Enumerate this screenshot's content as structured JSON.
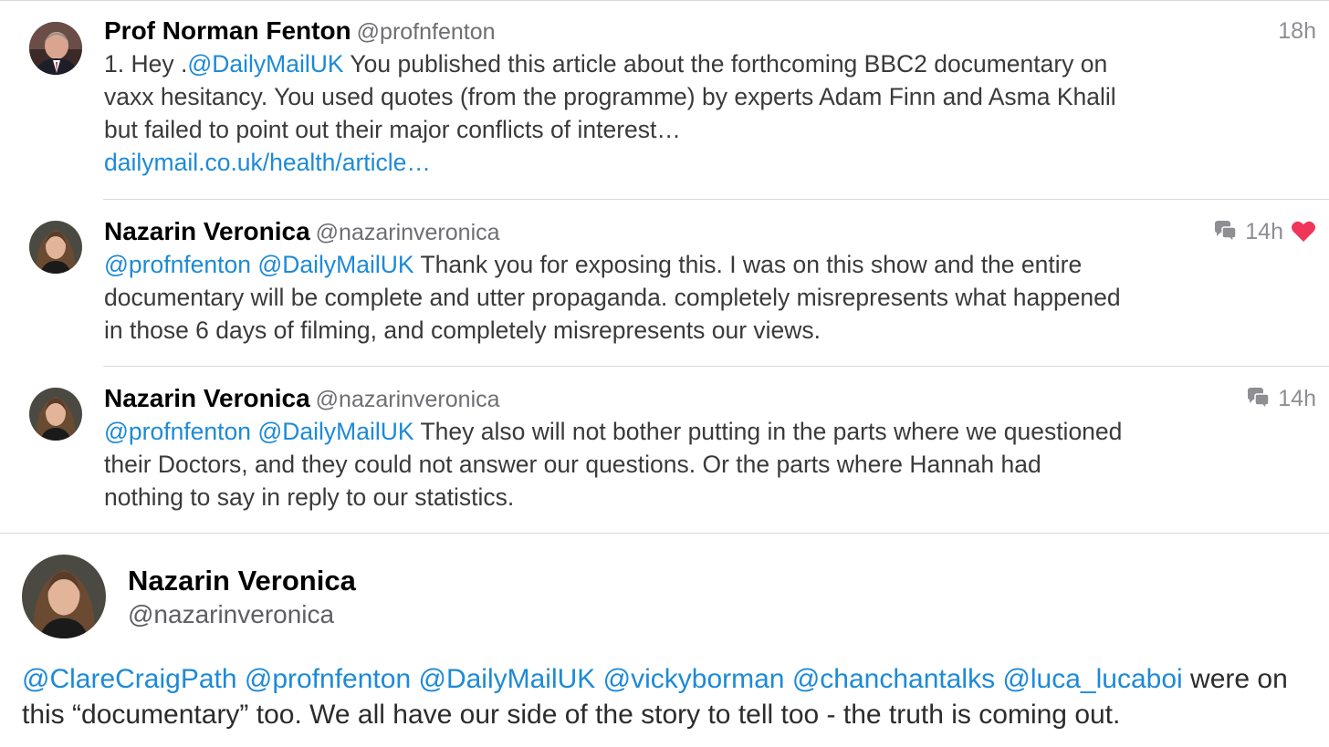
{
  "replies": [
    {
      "name": "Prof Norman Fenton",
      "handle": "@profnfenton",
      "time": "18h",
      "text_pre": "1. Hey .",
      "mention_1": "@DailyMailUK",
      "text_post": " You published this article about the forthcoming BBC2 documentary on vaxx hesitancy. You used quotes (from the programme) by experts Adam Finn and Asma Khalil but failed to point out their major conflicts of interest…",
      "link": "dailymail.co.uk/health/article…",
      "avatar_icon": "avatar-man-suit"
    },
    {
      "name": "Nazarin Veronica",
      "handle": "@nazarinveronica",
      "time": "14h",
      "mention_1": "@profnfenton",
      "mention_2": "@DailyMailUK",
      "text_post": " Thank you for exposing this. I was on this show and the entire documentary will be complete and utter propaganda. completely misrepresents what happened in those 6 days of filming, and completely misrepresents our views.",
      "reply_icon": "conversation-icon",
      "liked_icon": "heart-icon",
      "like_color": "#f0355a"
    },
    {
      "name": "Nazarin Veronica",
      "handle": "@nazarinveronica",
      "time": "14h",
      "mention_1": "@profnfenton",
      "mention_2": "@DailyMailUK",
      "text_post": " They also will not bother putting in the parts where we questioned their Doctors, and they could not answer our questions. Or the parts where Hannah had nothing to say in reply to our statistics.",
      "reply_icon": "conversation-icon"
    }
  ],
  "main_tweet": {
    "name": "Nazarin Veronica",
    "handle": "@nazarinveronica",
    "mentions": [
      "@ClareCraigPath",
      "@profnfenton",
      "@DailyMailUK",
      "@vickyborman",
      "@chanchantalks",
      "@luca_lucaboi"
    ],
    "text_post": " were on this “documentary” too. We all have our side of the story to tell too - the truth is coming out."
  },
  "colors": {
    "link": "#1d8ad6",
    "separator": "#d8d8dc",
    "meta_text": "#8e8e93"
  }
}
